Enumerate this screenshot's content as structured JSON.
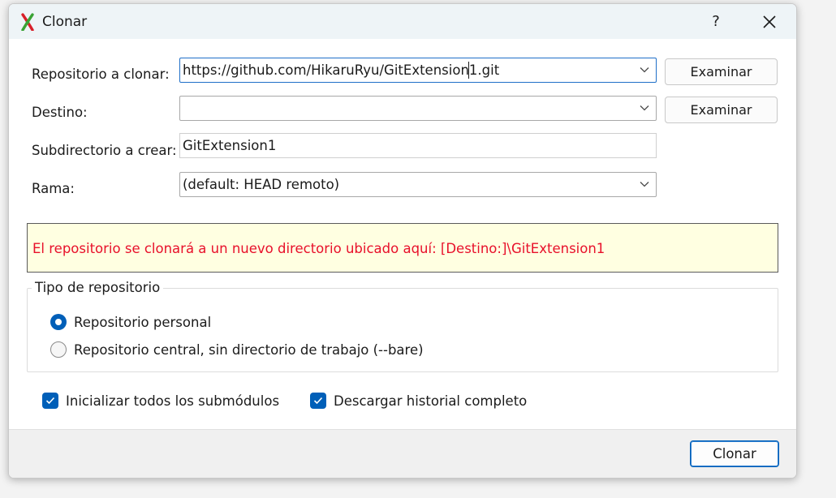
{
  "window": {
    "title": "Clonar",
    "help_label": "?",
    "icons": {
      "app": "git-extensions-logo-icon",
      "close": "close-icon",
      "dropdown": "chevron-down-icon",
      "check": "checkmark-icon"
    }
  },
  "form": {
    "repo_label": "Repositorio a clonar:",
    "repo_value": "https://github.com/HikaruRyu/GitExtension1.git",
    "repo_browse": "Examinar",
    "dest_label": "Destino:",
    "dest_value": "",
    "dest_browse": "Examinar",
    "subdir_label": "Subdirectorio a crear:",
    "subdir_value": "GitExtension1",
    "branch_label": "Rama:",
    "branch_value": "(default: HEAD remoto)"
  },
  "notice": {
    "text": "El repositorio se clonará a un nuevo directorio ubicado aquí: [Destino:]\\GitExtension1",
    "text_color": "#e8102a",
    "background": "#ffffe1"
  },
  "repo_type": {
    "title": "Tipo de repositorio",
    "options": [
      {
        "label": "Repositorio personal",
        "selected": true
      },
      {
        "label": "Repositorio central, sin directorio de trabajo (--bare)",
        "selected": false
      }
    ]
  },
  "options": {
    "init_submodules": {
      "label": "Inicializar todos los submódulos",
      "checked": true
    },
    "full_history": {
      "label": "Descargar historial completo",
      "checked": true
    }
  },
  "footer": {
    "clone_button": "Clonar"
  },
  "colors": {
    "accent": "#005fb8"
  }
}
